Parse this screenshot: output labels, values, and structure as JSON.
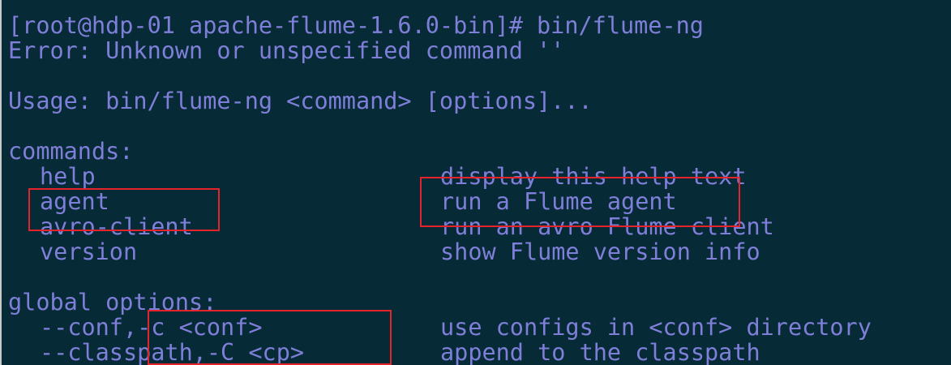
{
  "terminal": {
    "prompt_line": "[root@hdp-01 apache-flume-1.6.0-bin]# bin/flume-ng",
    "error_line": "Error: Unknown or unspecified command ''",
    "usage_line": "Usage: bin/flume-ng <command> [options]...",
    "commands_header": "commands:",
    "commands": [
      {
        "name": "help",
        "description": "display this help text"
      },
      {
        "name": "agent",
        "description": "run a Flume agent"
      },
      {
        "name": "avro-client",
        "description": "run an avro Flume client"
      },
      {
        "name": "version",
        "description": "show Flume version info"
      }
    ],
    "global_options_header": "global options:",
    "options": [
      {
        "flag": "--conf,-c <conf>",
        "description": "use configs in <conf> directory"
      },
      {
        "flag": "--classpath,-C <cp>",
        "description": "append to the classpath"
      }
    ]
  },
  "colors": {
    "background": "#062b36",
    "text": "#7f7fd9",
    "highlight_box": "#e5232a"
  }
}
